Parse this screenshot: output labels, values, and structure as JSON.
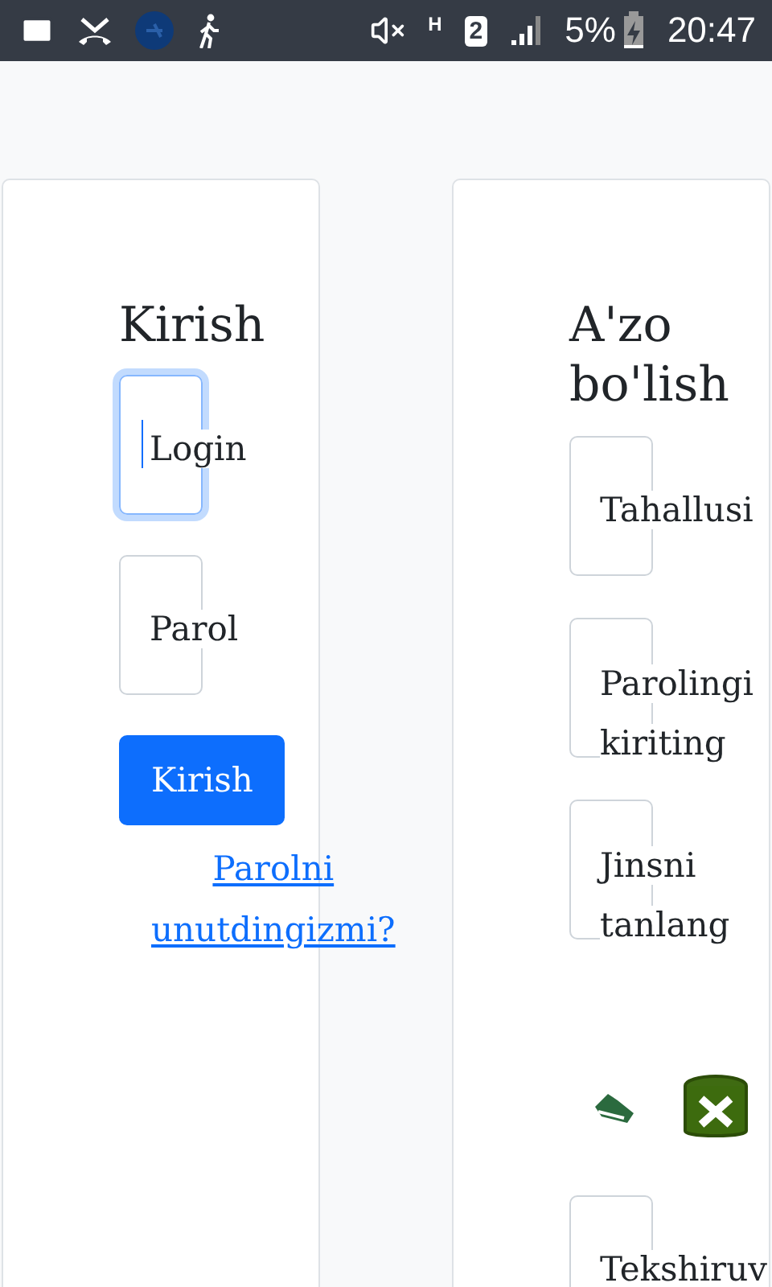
{
  "status_bar": {
    "network_type": "H",
    "sim_slot": "2",
    "battery": "5%",
    "time": "20:47"
  },
  "login": {
    "title": "Kirish",
    "fields": [
      {
        "placeholder": "Login",
        "focused": true
      },
      {
        "placeholder": "Parol",
        "focused": false
      }
    ],
    "submit": "Kirish",
    "forgot_link": "Parolni unutdingizmi?"
  },
  "register": {
    "title": "A'zo bo'lish",
    "items": [
      {
        "kind": "field",
        "placeholder": "Tahallusi",
        "focused": false
      },
      {
        "kind": "field",
        "placeholder": "Parolingi\nkiriting",
        "focused": false
      },
      {
        "kind": "field",
        "placeholder": "Jinsni\ntanlang",
        "focused": false
      },
      {
        "kind": "icons"
      },
      {
        "kind": "field",
        "placeholder": "Tekshiruv",
        "focused": false
      }
    ]
  }
}
